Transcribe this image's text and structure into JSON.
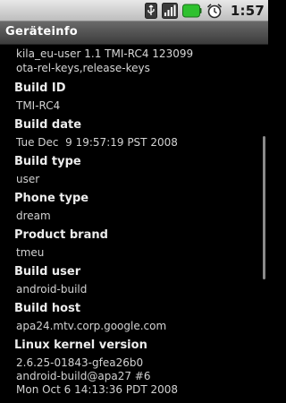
{
  "status_bar": {
    "time": "1:57",
    "icons": [
      "usb-icon",
      "signal-icon",
      "battery-icon",
      "alarm-icon"
    ]
  },
  "title": "Geräteinfo",
  "top_lines": [
    "kila_eu-user 1.1 TMI-RC4 123099",
    "ota-rel-keys,release-keys"
  ],
  "fields": [
    {
      "label": "Build ID",
      "values": [
        "TMI-RC4"
      ]
    },
    {
      "label": "Build date",
      "values": [
        "Tue Dec  9 19:57:19 PST 2008"
      ]
    },
    {
      "label": "Build type",
      "values": [
        "user"
      ]
    },
    {
      "label": "Phone type",
      "values": [
        "dream"
      ]
    },
    {
      "label": "Product brand",
      "values": [
        "tmeu"
      ]
    },
    {
      "label": "Build user",
      "values": [
        "android-build"
      ]
    },
    {
      "label": "Build host",
      "values": [
        "apa24.mtv.corp.google.com"
      ]
    },
    {
      "label": "Linux kernel version",
      "values": [
        "2.6.25-01843-gfea26b0",
        "android-build@apa27 #6",
        "Mon Oct 6 14:13:36 PDT 2008"
      ]
    }
  ],
  "colors": {
    "background": "#000000",
    "label": "#ececec",
    "value": "#d2d2d2",
    "title_bar": "#4a4a4a",
    "battery": "#33cc33"
  }
}
